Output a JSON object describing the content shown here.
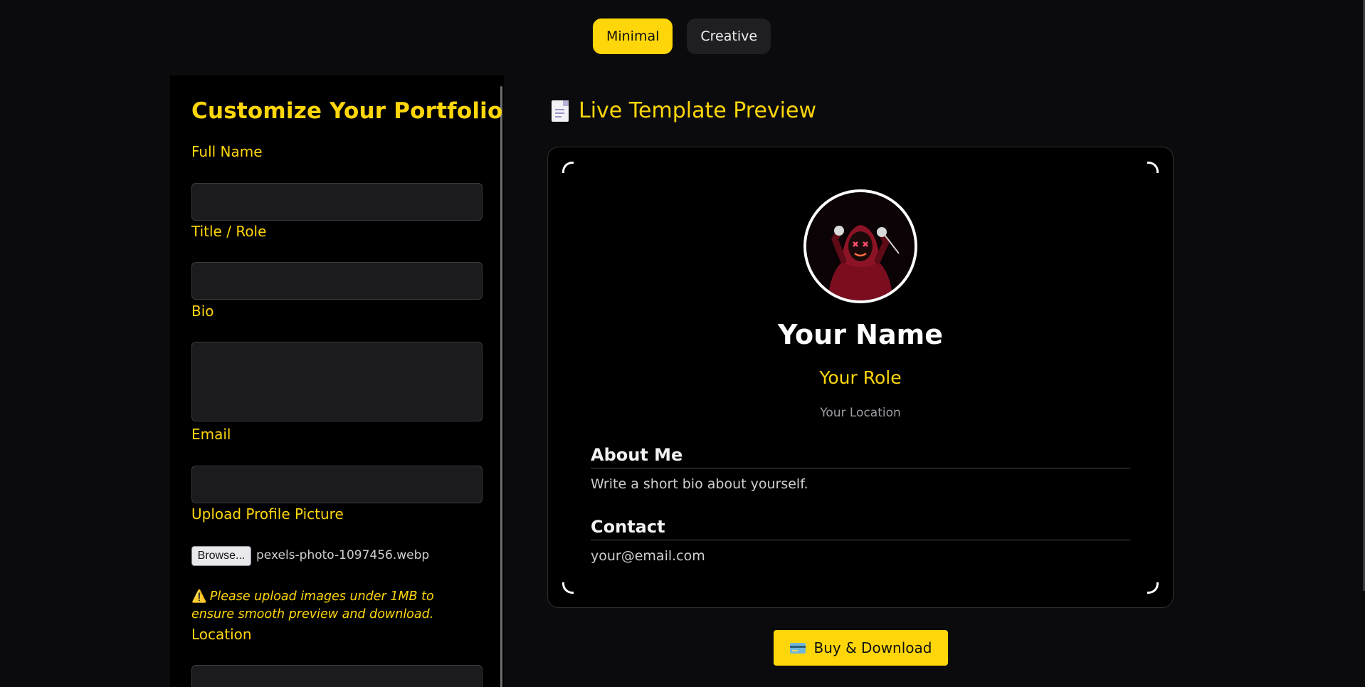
{
  "template_toggle": {
    "options": [
      "Minimal",
      "Creative"
    ],
    "selected": "Minimal"
  },
  "form": {
    "title": "Customize Your Portfolio",
    "fields": {
      "full_name": {
        "label": "Full Name",
        "value": ""
      },
      "title_role": {
        "label": "Title / Role",
        "value": ""
      },
      "bio": {
        "label": "Bio",
        "value": ""
      },
      "email": {
        "label": "Email",
        "value": ""
      },
      "profile_picture": {
        "label": "Upload Profile Picture",
        "button_label": "Browse...",
        "file_name": "pexels-photo-1097456.webp"
      },
      "location": {
        "label": "Location",
        "value": ""
      }
    },
    "warning": {
      "icon": "warning-icon",
      "text": "Please upload images under 1MB to ensure smooth preview and download."
    }
  },
  "preview": {
    "heading_icon": "document-icon",
    "heading": "Live Template Preview",
    "name": "Your Name",
    "role": "Your Role",
    "location": "Your Location",
    "about_heading": "About Me",
    "about_text": "Write a short bio about yourself.",
    "contact_heading": "Contact",
    "contact_text": "your@email.com"
  },
  "actions": {
    "buy_icon": "credit-card-icon",
    "buy_label": "Buy & Download"
  },
  "colors": {
    "accent": "#ffd60a",
    "background": "#0b0b0d",
    "panel": "#000000",
    "input": "#1b1b1e"
  }
}
